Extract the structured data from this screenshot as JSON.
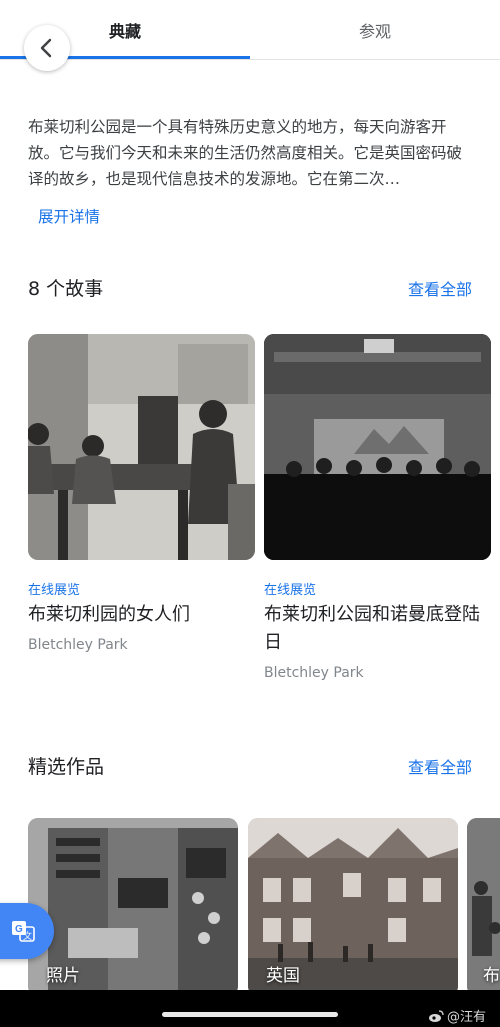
{
  "header": {
    "tab_collection": "典藏",
    "tab_visit": "参观",
    "back_icon": "chevron-left-icon"
  },
  "about": {
    "description": "布莱切利公园是一个具有特殊历史意义的地方，每天向游客开放。它与我们今天和未来的生活仍然高度相关。它是英国密码破译的故乡，也是现代信息技术的发源地。它在第二次…",
    "expand_label": "展开详情"
  },
  "stories": {
    "title": "8 个故事",
    "view_all": "查看全部",
    "items": [
      {
        "type": "在线展览",
        "title": "布莱切利园的女人们",
        "source": "Bletchley Park"
      },
      {
        "type": "在线展览",
        "title": "布莱切利公园和诺曼底登陆日",
        "source": "Bletchley Park"
      }
    ]
  },
  "featured": {
    "title": "精选作品",
    "view_all": "查看全部",
    "items": [
      {
        "label": "照片"
      },
      {
        "label": "英国"
      },
      {
        "label": "布"
      }
    ]
  },
  "watermark": {
    "text": "@汪有"
  },
  "colors": {
    "accent": "#1a73e8",
    "translate": "#4285f4"
  }
}
